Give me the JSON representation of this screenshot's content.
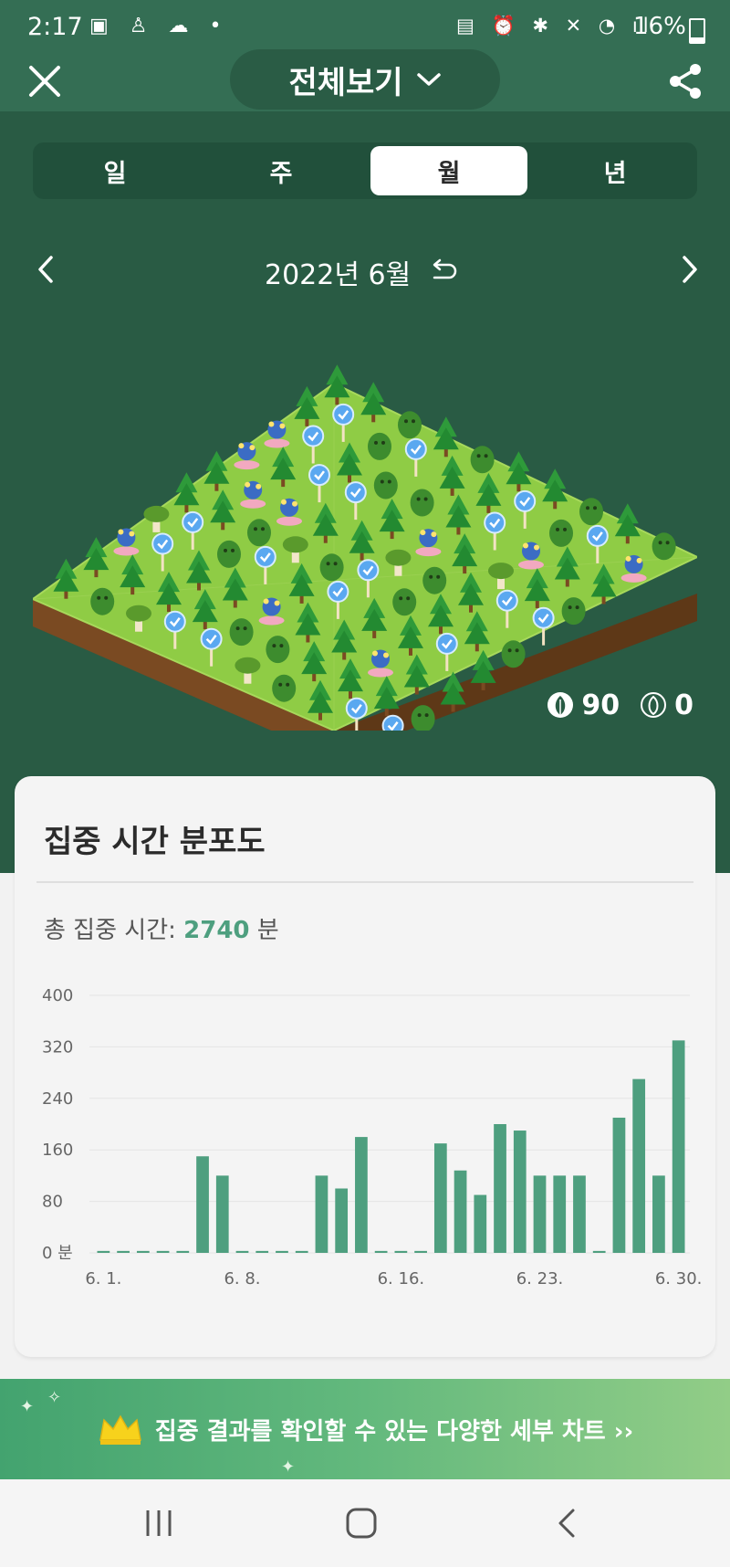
{
  "status_bar": {
    "time": "2:17",
    "battery": "16%",
    "left_icons": "▣ ♙ ☁ •",
    "right_icons": "▤ ⏰ ✱ ✕ ◔ ıl"
  },
  "header": {
    "title": "전체보기"
  },
  "tabs": [
    {
      "label": "일",
      "active": false
    },
    {
      "label": "주",
      "active": false
    },
    {
      "label": "월",
      "active": true
    },
    {
      "label": "년",
      "active": false
    }
  ],
  "period": {
    "label": "2022년 6월"
  },
  "forest": {
    "healthy_count": "90",
    "dead_count": "0"
  },
  "card": {
    "title": "집중 시간 분포도",
    "total_label": "총 집중 시간:",
    "total_value": "2740",
    "total_unit": "분"
  },
  "chart_data": {
    "type": "bar",
    "title": "집중 시간 분포도",
    "y_unit": "분",
    "ylim": [
      0,
      400
    ],
    "y_ticks": [
      "0 분",
      "80",
      "160",
      "240",
      "320",
      "400"
    ],
    "x_tick_labels": [
      {
        "day": 1,
        "label": "6. 1."
      },
      {
        "day": 8,
        "label": "6. 8."
      },
      {
        "day": 16,
        "label": "6. 16."
      },
      {
        "day": 23,
        "label": "6. 23."
      },
      {
        "day": 30,
        "label": "6. 30."
      }
    ],
    "categories": [
      "6. 1.",
      "6. 2.",
      "6. 3.",
      "6. 4.",
      "6. 5.",
      "6. 6.",
      "6. 7.",
      "6. 8.",
      "6. 9.",
      "6. 10.",
      "6. 11.",
      "6. 12.",
      "6. 13.",
      "6. 14.",
      "6. 15.",
      "6. 16.",
      "6. 17.",
      "6. 18.",
      "6. 19.",
      "6. 20.",
      "6. 21.",
      "6. 22.",
      "6. 23.",
      "6. 24.",
      "6. 25.",
      "6. 26.",
      "6. 27.",
      "6. 28.",
      "6. 29.",
      "6. 30."
    ],
    "values": [
      0,
      0,
      0,
      0,
      0,
      150,
      120,
      0,
      0,
      0,
      0,
      120,
      100,
      180,
      0,
      0,
      0,
      170,
      128,
      90,
      200,
      190,
      120,
      120,
      120,
      0,
      210,
      270,
      120,
      330
    ],
    "bar_color": "#4e9f7f",
    "grid": true
  },
  "banner": {
    "text": "집중 결과를 확인할 수 있는 다양한 세부 차트 ››"
  },
  "colors": {
    "accent": "#4e9f7f",
    "header_bg": "#346e54",
    "dark_green": "#295b44"
  }
}
